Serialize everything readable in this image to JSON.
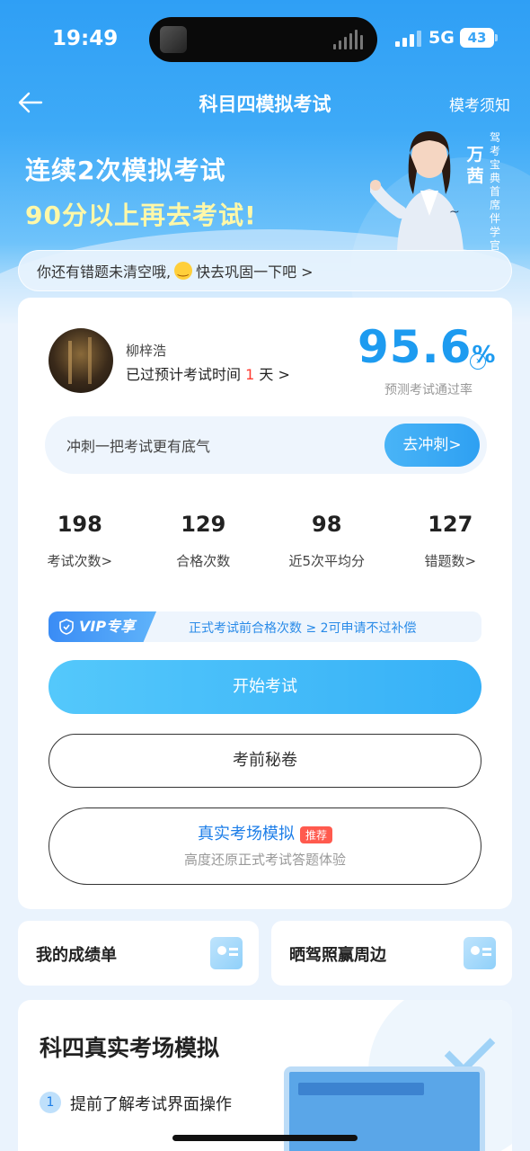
{
  "status_bar": {
    "time": "19:49",
    "network": "5G",
    "battery": "43"
  },
  "nav": {
    "title": "科目四模拟考试",
    "right_link": "模考须知"
  },
  "banner": {
    "line1": "连续2次模拟考试",
    "line2": "90分以上再去考试!",
    "person_name": "万茜",
    "person_title": "驾考宝典首席伴学官"
  },
  "notice": {
    "text_before": "你还有错题未清空哦,",
    "text_after": "快去巩固一下吧 >"
  },
  "profile": {
    "username": "柳梓浩",
    "exam_days_prefix": "已过预计考试时间",
    "exam_days_value": "1",
    "exam_days_suffix": "天 >",
    "pass_rate": "95.6",
    "pass_rate_unit": "%",
    "pass_rate_label": "预测考试通过率"
  },
  "sprint": {
    "text": "冲刺一把考试更有底气",
    "button": "去冲刺>"
  },
  "stats": [
    {
      "value": "198",
      "label": "考试次数>"
    },
    {
      "value": "129",
      "label": "合格次数"
    },
    {
      "value": "98",
      "label": "近5次平均分"
    },
    {
      "value": "127",
      "label": "错题数>"
    }
  ],
  "vip": {
    "tag": "VIP专享",
    "text": "正式考试前合格次数 ≥ 2可申请不过补偿"
  },
  "buttons": {
    "start_exam": "开始考试",
    "secret_paper": "考前秘卷",
    "real_sim_title": "真实考场模拟",
    "real_sim_tag": "推荐",
    "real_sim_desc": "高度还原正式考试答题体验"
  },
  "mini_cards": {
    "left": "我的成绩单",
    "right": "晒驾照赢周边"
  },
  "bottom_card": {
    "title": "科四真实考场模拟",
    "item1_num": "1",
    "item1_text": "提前了解考试界面操作"
  },
  "colors": {
    "primary": "#1d9bf0",
    "accent_red": "#ff3b30",
    "banner_yellow": "#fff8a8"
  }
}
